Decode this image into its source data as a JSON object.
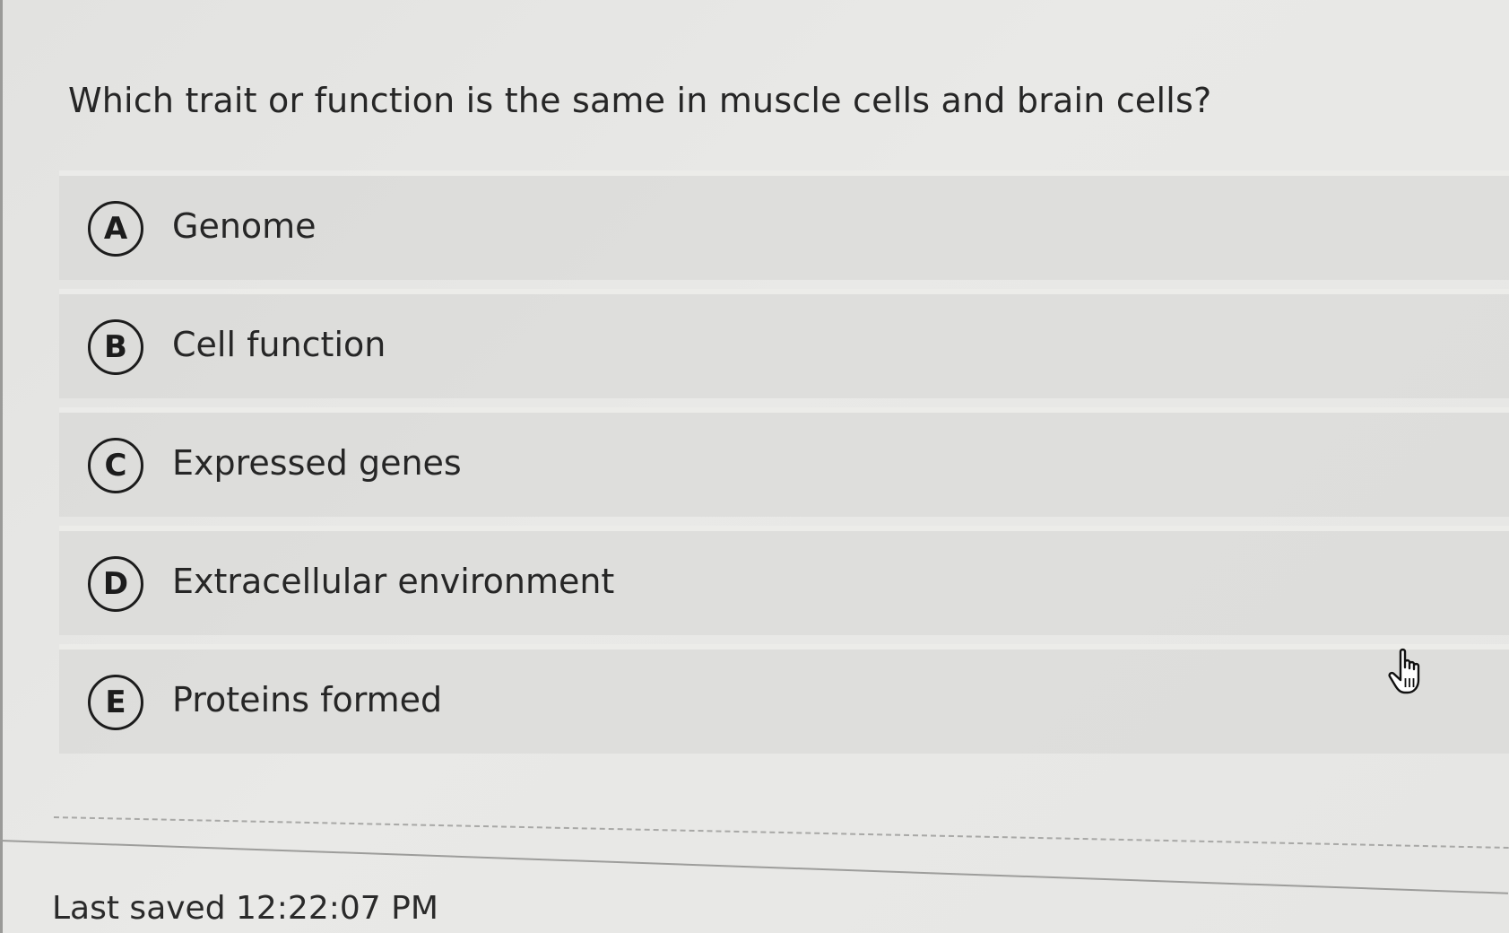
{
  "question": {
    "text": "Which trait or function is the same in muscle cells and brain cells?"
  },
  "options": [
    {
      "letter": "A",
      "label": "Genome"
    },
    {
      "letter": "B",
      "label": "Cell function"
    },
    {
      "letter": "C",
      "label": "Expressed genes"
    },
    {
      "letter": "D",
      "label": "Extracellular environment"
    },
    {
      "letter": "E",
      "label": "Proteins formed"
    }
  ],
  "footer": {
    "last_saved": "Last saved 12:22:07 PM"
  },
  "icons": {
    "cursor": "hand-pointer-icon"
  }
}
